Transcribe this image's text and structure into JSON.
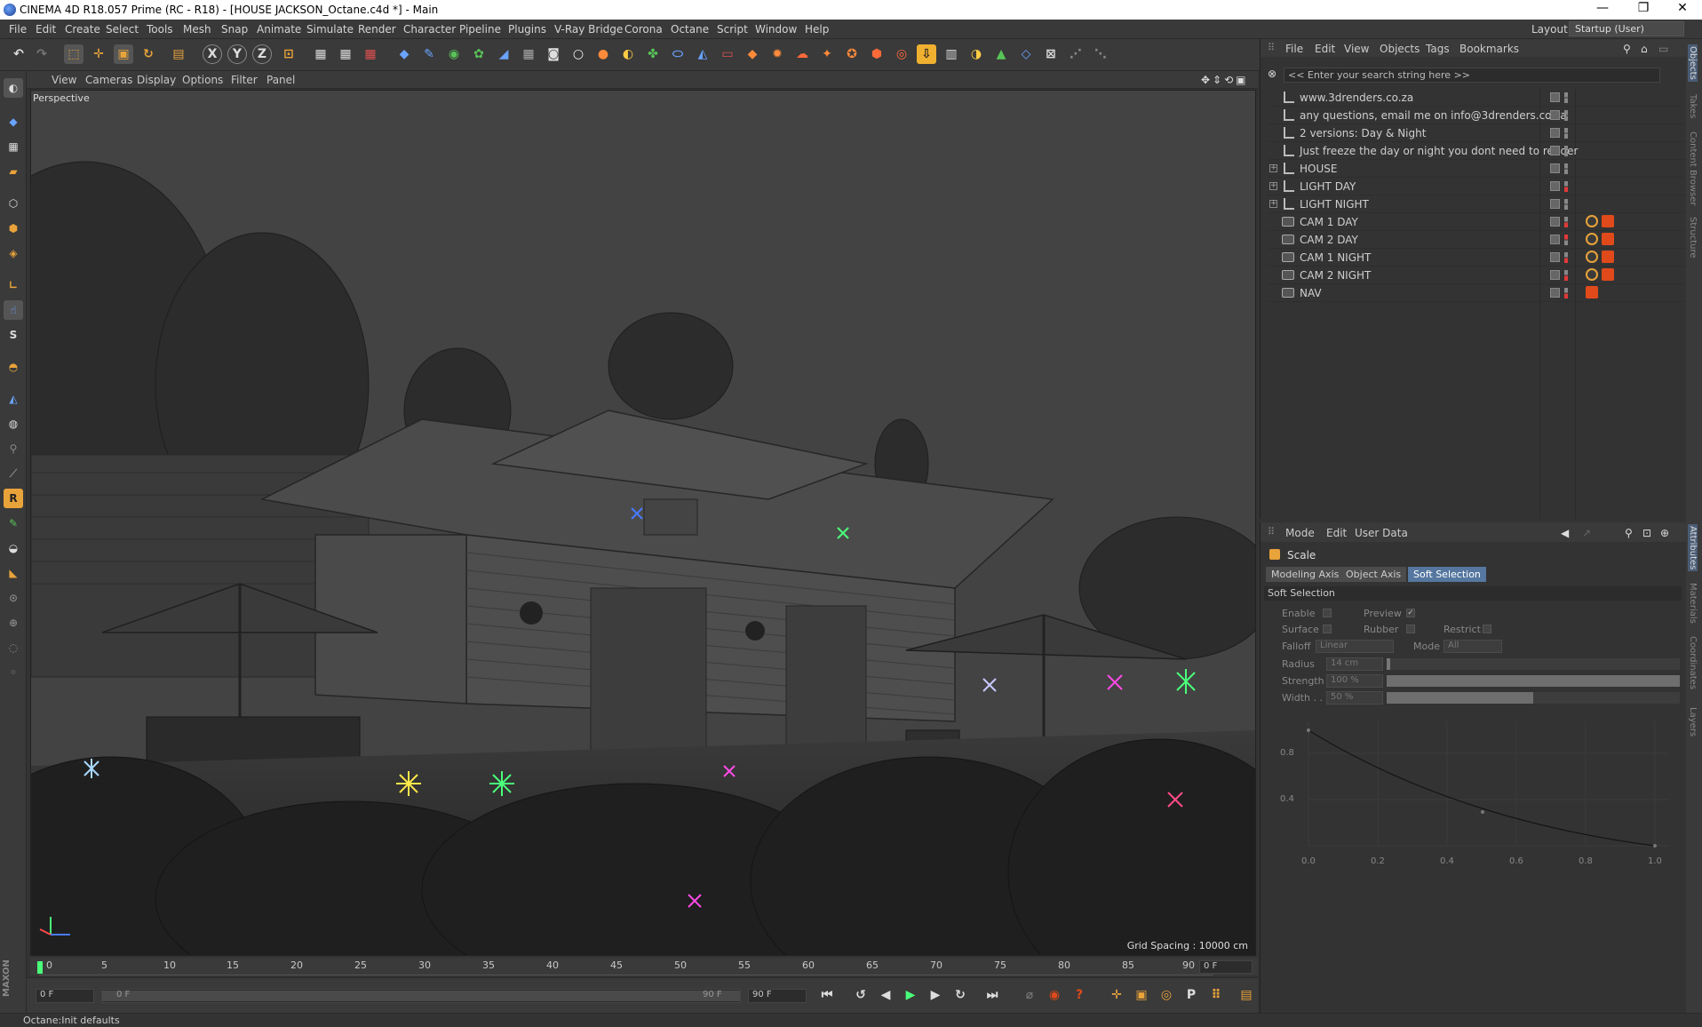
{
  "window": {
    "title": "CINEMA 4D R18.057 Prime (RC - R18) - [HOUSE JACKSON_Octane.c4d *] - Main",
    "minimize": "—",
    "restore": "❐",
    "close": "✕"
  },
  "menubar": {
    "items": [
      "File",
      "Edit",
      "Create",
      "Select",
      "Tools",
      "Mesh",
      "Snap",
      "Animate",
      "Simulate",
      "Render",
      "Character",
      "Pipeline",
      "Plugins",
      "V-Ray Bridge",
      "Corona",
      "Octane",
      "Script",
      "Window",
      "Help"
    ],
    "layout_label": "Layout:",
    "layout_value": "Startup (User)"
  },
  "viewport": {
    "menu": [
      "View",
      "Cameras",
      "Display",
      "Options",
      "Filter",
      "Panel"
    ],
    "label": "Perspective",
    "grid_spacing": "Grid Spacing : 10000 cm"
  },
  "timeline": {
    "ticks": [
      "0",
      "5",
      "10",
      "15",
      "20",
      "25",
      "30",
      "35",
      "40",
      "45",
      "50",
      "55",
      "60",
      "65",
      "70",
      "75",
      "80",
      "85",
      "90"
    ],
    "current_frame": "0 F",
    "start_field": "0 F",
    "range_start": "0 F",
    "range_end": "90 F",
    "end_field": "90 F"
  },
  "status": {
    "text": "Octane:Init defaults"
  },
  "object_manager": {
    "menu": [
      "File",
      "Edit",
      "View",
      "Objects",
      "Tags",
      "Bookmarks"
    ],
    "search_placeholder": "<< Enter your search string here >>",
    "objects": [
      {
        "name": "www.3drenders.co.za",
        "type": "null",
        "expand": false,
        "tags": 0
      },
      {
        "name": "any questions, email me on info@3drenders.co.za",
        "type": "null",
        "expand": false,
        "tags": 0
      },
      {
        "name": "2 versions: Day & Night",
        "type": "null",
        "expand": false,
        "tags": 0
      },
      {
        "name": "Just freeze the day or night you dont need to render",
        "type": "null",
        "expand": false,
        "tags": 0
      },
      {
        "name": "HOUSE",
        "type": "null",
        "expand": true,
        "tags": 0
      },
      {
        "name": "LIGHT DAY",
        "type": "null",
        "expand": true,
        "tags": 0
      },
      {
        "name": "LIGHT NIGHT",
        "type": "null",
        "expand": true,
        "tags": 0
      },
      {
        "name": "CAM 1 DAY",
        "type": "camera",
        "expand": false,
        "tags": 2
      },
      {
        "name": "CAM 2 DAY",
        "type": "camera",
        "expand": false,
        "tags": 2
      },
      {
        "name": "CAM 1 NIGHT",
        "type": "camera",
        "expand": false,
        "tags": 2
      },
      {
        "name": "CAM 2 NIGHT",
        "type": "camera",
        "expand": false,
        "tags": 2
      },
      {
        "name": "NAV",
        "type": "camera",
        "expand": false,
        "tags": 1
      }
    ]
  },
  "attribute_manager": {
    "menu": [
      "Mode",
      "Edit",
      "User Data"
    ],
    "object_name": "Scale",
    "tabs": [
      "Modeling Axis",
      "Object Axis",
      "Soft Selection"
    ],
    "active_tab": "Soft Selection",
    "section": "Soft Selection",
    "fields": {
      "enable": "Enable",
      "preview": "Preview",
      "surface": "Surface",
      "rubber": "Rubber",
      "restrict": "Restrict",
      "falloff": "Falloff",
      "falloff_value": "Linear",
      "mode": "Mode",
      "mode_value": "All",
      "radius": "Radius",
      "radius_value": "14 cm",
      "strength": "Strength",
      "strength_value": "100 %",
      "width": "Width . .",
      "width_value": "50 %"
    },
    "graph": {
      "y_ticks": [
        "0.8",
        "0.4"
      ],
      "x_ticks": [
        "0.0",
        "0.2",
        "0.4",
        "0.6",
        "0.8",
        "1.0"
      ]
    }
  },
  "right_tabs": [
    "Objects",
    "Takes",
    "Content Browser",
    "Structure",
    "Attributes",
    "Materials",
    "Coordinates",
    "Layers"
  ],
  "colors": {
    "accent": "#5577a0",
    "tag_orange": "#e04a1a",
    "tag_red": "#cc2222"
  }
}
